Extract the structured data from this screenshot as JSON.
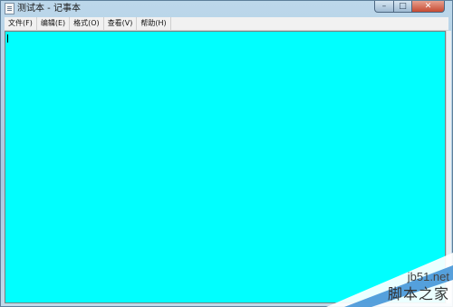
{
  "window": {
    "title": "测试本 - 记事本",
    "controls": {
      "minimize": "–",
      "maximize": "□",
      "close": "✕"
    }
  },
  "menubar": {
    "items": [
      {
        "label": "文件(F)"
      },
      {
        "label": "编辑(E)"
      },
      {
        "label": "格式(O)"
      },
      {
        "label": "查看(V)"
      },
      {
        "label": "帮助(H)"
      }
    ]
  },
  "editor": {
    "content": "",
    "background": "#00ffff"
  },
  "watermark": {
    "site": "jb51.net",
    "name": "脚本之家"
  },
  "icons": [
    "notepad-icon"
  ]
}
